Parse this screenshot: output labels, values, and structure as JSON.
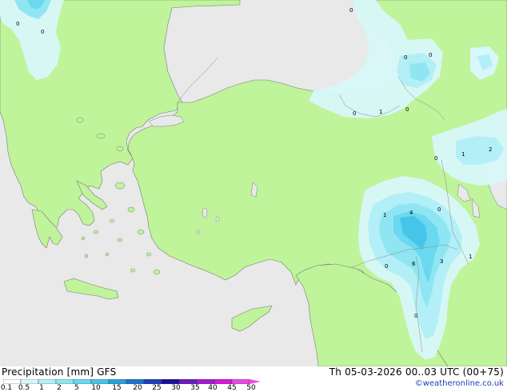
{
  "title": {
    "product": "Precipitation [mm]",
    "model": "GFS",
    "valid": "Th 05-03-2026 00..03 UTC (00+75)"
  },
  "credit": "©weatheronline.co.uk",
  "legend": {
    "labels": [
      "0.1",
      "0.5",
      "1",
      "2",
      "5",
      "10",
      "15",
      "20",
      "25",
      "30",
      "35",
      "40",
      "45",
      "50"
    ],
    "colors": [
      "#fdfdfd",
      "#d8f7fa",
      "#b3eff6",
      "#8fe6f2",
      "#6ad8ee",
      "#46c5ea",
      "#2aa2de",
      "#1f73cd",
      "#1b3fb8",
      "#1a0f9a",
      "#6a1ac0",
      "#a31ad2",
      "#d21ad8",
      "#e84ae6"
    ]
  },
  "map": {
    "colors": {
      "sea": "#e9e9e9",
      "land": "#bff49a",
      "coast": "#7a7a7a"
    },
    "point_labels": [
      "0",
      "0",
      "0",
      "0",
      "0",
      "0",
      "1",
      "0",
      "0",
      "1",
      "2",
      "1",
      "4",
      "0",
      "0",
      "6",
      "3",
      "1",
      "0"
    ]
  }
}
